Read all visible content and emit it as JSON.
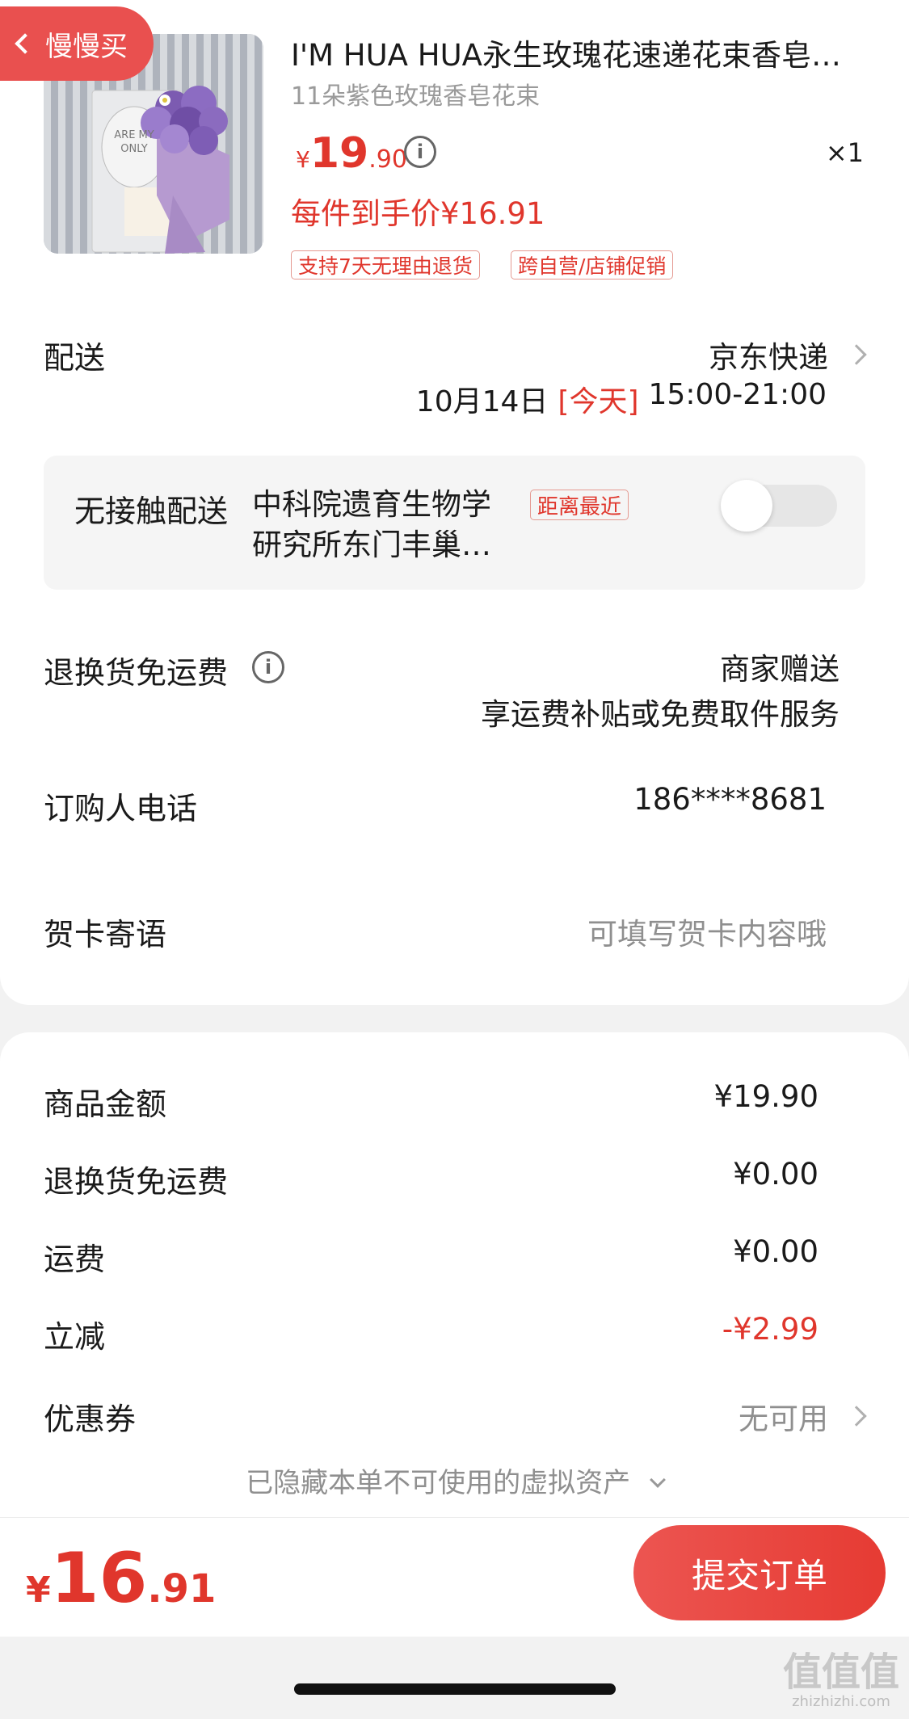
{
  "nav": {
    "back_label": "慢慢买"
  },
  "product": {
    "title": "I'M HUA HUA永生玫瑰花速递花束香皂花礼盒",
    "subtitle": "11朵紫色玫瑰香皂花束",
    "price_yen": "¥",
    "price_int": "19",
    "price_dec": ".90",
    "info_icon": "i",
    "quantity": "×1",
    "unit_price": "每件到手价¥16.91",
    "tags": [
      "支持7天无理由退货",
      "跨自营/店铺促销"
    ],
    "image_text": [
      "ARE MY",
      "ONLY"
    ]
  },
  "delivery": {
    "label": "配送",
    "carrier": "京东快递",
    "date": "10月14日",
    "today": "[今天]",
    "time": "15:00-21:00"
  },
  "contactless": {
    "label": "无接触配送",
    "address_line1": "中科院遗育生物学",
    "address_line2": "研究所东门丰巢…",
    "badge": "距离最近",
    "enabled": false
  },
  "return_freight": {
    "label": "退换货免运费",
    "value_line1": "商家赠送",
    "value_line2": "享运费补贴或免费取件服务"
  },
  "phone": {
    "label": "订购人电话",
    "value": "186****8681"
  },
  "greeting": {
    "label": "贺卡寄语",
    "placeholder": "可填写贺卡内容哦"
  },
  "summary": {
    "rows": [
      {
        "label": "商品金额",
        "value": "¥19.90"
      },
      {
        "label": "退换货免运费",
        "value": "¥0.00"
      },
      {
        "label": "运费",
        "value": "¥0.00"
      },
      {
        "label": "立减",
        "value": "-¥2.99"
      },
      {
        "label": "优惠券",
        "value": "无可用"
      }
    ],
    "hidden_assets": "已隐藏本单不可使用的虚拟资产"
  },
  "footer": {
    "total_yen": "¥",
    "total_int": "16",
    "total_dec": ".91",
    "submit_label": "提交订单"
  },
  "watermark": {
    "text": "值值值",
    "url": "zhizhizhi.com"
  },
  "colors": {
    "accent_red": "#e0362c",
    "pill_red": "#e9504f"
  }
}
